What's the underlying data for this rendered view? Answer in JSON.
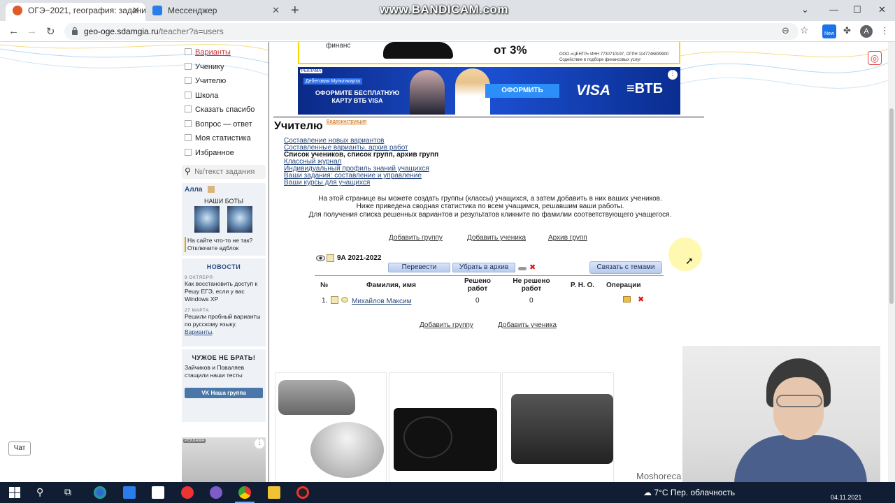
{
  "browser": {
    "tabs": [
      {
        "title": "ОГЭ−2021, география: задания,",
        "active": true
      },
      {
        "title": "Мессенджер",
        "active": false
      }
    ],
    "url_host": "geo-oge.sdamgia.ru",
    "url_path": "/teacher?a=users",
    "ext_badge": "New",
    "avatar_letter": "A",
    "watermark": "www.BANDICAM.com"
  },
  "sidebar": {
    "menu": [
      {
        "label": "Варианты",
        "active": true
      },
      {
        "label": "Ученику"
      },
      {
        "label": "Учителю"
      },
      {
        "label": "Школа"
      },
      {
        "label": "Сказать спасибо"
      },
      {
        "label": "Вопрос — ответ"
      },
      {
        "label": "Моя статистика"
      },
      {
        "label": "Избранное"
      }
    ],
    "search_placeholder": "№/текст задания",
    "user_name": "Алла",
    "bots_title": "НАШИ БОТЫ",
    "adblock_note": "На сайте что-то не так? Отключите адблок",
    "news_title": "НОВОСТИ",
    "news": [
      {
        "date": "9 ОКТЯБРЯ",
        "text": "Как восстановить доступ к Решу ЕГЭ, если у вас Windows XP",
        "link": ""
      },
      {
        "date": "27 МАРТА",
        "text": "Решили пробный варианты по русскому языку. ",
        "link": "Варианты"
      }
    ],
    "steal_title": "ЧУЖОЕ НЕ БРАТЬ!",
    "steal_text": "Зайчиков и Поваляев стащили наши тесты",
    "vk_button": "Наша группа",
    "ad_tag": "РЕКЛАМА"
  },
  "ads": {
    "top_finance": "финанс",
    "top_percent": "от 3%",
    "top_fine": "ООО «ЦЕНТР» ИНН 7730710197, ОГРН 1147746839900\nСодействие в подборе финансовых услуг",
    "vtb_tag": "РЕКЛАМА",
    "vtb_sub": "Дебетовая Мультикарта",
    "vtb_headline": "ОФОРМИТЕ БЕСПЛАТНУЮ КАРТУ ВТБ VISA",
    "vtb_cta": "ОФОРМИТЬ",
    "vtb_visa": "VISA",
    "vtb_brand": "ВТБ"
  },
  "main": {
    "title": "Учителю",
    "video_link": "Видеоинструкция",
    "links": [
      {
        "label": "Составление новых вариантов",
        "current": false
      },
      {
        "label": "Составленные варианты, архив работ",
        "current": false
      },
      {
        "label": "Список учеников, список групп, архив групп",
        "current": true
      },
      {
        "label": "Классный журнал",
        "current": false
      },
      {
        "label": "Индивидуальный профиль знаний учащихся",
        "current": false
      },
      {
        "label": "Ваши задания: составление и управление",
        "current": false
      },
      {
        "label": "Ваши курсы для учащихся",
        "current": false
      }
    ],
    "info": [
      "На этой странице вы можете создать группы (классы) учащихся, а затем добавить в них ваших учеников.",
      "Ниже приведена сводная статистика по всем учащимся, решавшим ваши работы.",
      "Для получения списка решенных вариантов и результатов кликните по фамилии соответствующего учащегося."
    ],
    "add_group": "Добавить группу",
    "add_student": "Добавить ученика",
    "group_archive": "Архив групп",
    "group": {
      "name": "9А 2021-2022",
      "btn_transfer": "Перевести",
      "btn_archive": "Убрать в архив",
      "btn_link_topics": "Связать с темами"
    },
    "table": {
      "headers": [
        "№",
        "Фамилия, имя",
        "Решено работ",
        "Не решено работ",
        "Р. Н. О.",
        "Операции"
      ],
      "rows": [
        {
          "num": "1.",
          "name": "Михайлов Максим",
          "solved": "0",
          "unsolved": "0",
          "rno": ""
        }
      ]
    }
  },
  "widgets": {
    "chat_label": "Чат",
    "moshoreca": "Moshoreca"
  },
  "taskbar": {
    "weather": "7°C  Пер. облачность",
    "date": "04.11.2021"
  }
}
